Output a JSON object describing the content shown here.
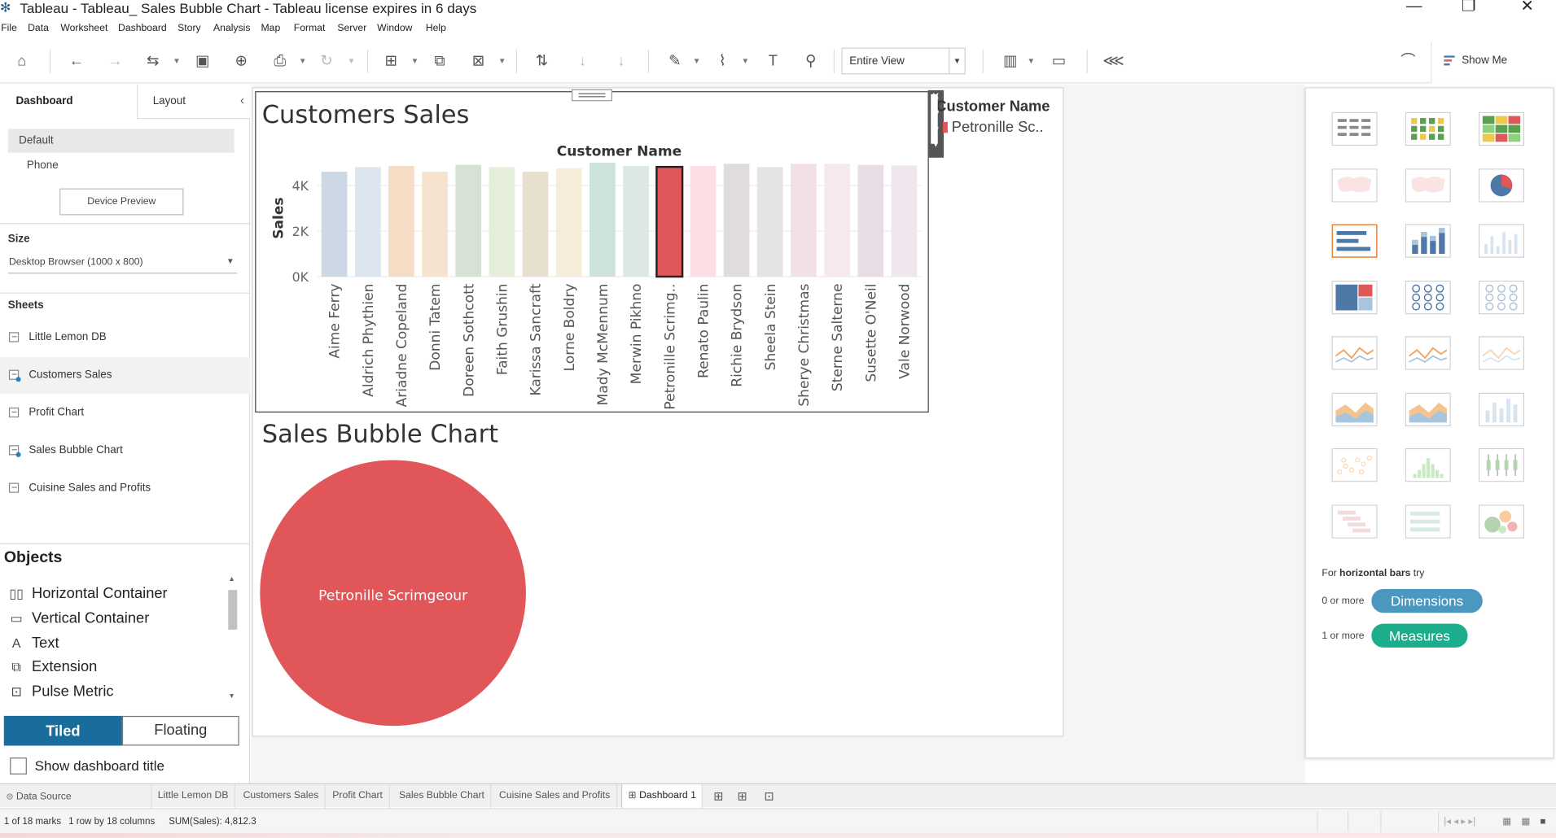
{
  "window": {
    "title": "Tableau - Tableau_ Sales Bubble Chart - Tableau license expires in 6 days"
  },
  "menu": [
    "File",
    "Data",
    "Worksheet",
    "Dashboard",
    "Story",
    "Analysis",
    "Map",
    "Format",
    "Server",
    "Window",
    "Help"
  ],
  "toolbar": {
    "fit_value": "Entire View",
    "show_me_label": "Show Me"
  },
  "left_panel": {
    "tabs": {
      "dashboard": "Dashboard",
      "layout": "Layout"
    },
    "devices": {
      "default": "Default",
      "phone": "Phone",
      "preview_button": "Device Preview"
    },
    "size": {
      "label": "Size",
      "value": "Desktop Browser (1000 x 800)"
    },
    "sheets_label": "Sheets",
    "sheets": [
      {
        "label": "Little Lemon DB",
        "used": false,
        "selected": false
      },
      {
        "label": "Customers Sales",
        "used": true,
        "selected": true
      },
      {
        "label": "Profit Chart",
        "used": false,
        "selected": false
      },
      {
        "label": "Sales Bubble Chart",
        "used": true,
        "selected": false
      },
      {
        "label": "Cuisine Sales and Profits",
        "used": false,
        "selected": false
      }
    ],
    "objects_label": "Objects",
    "objects": [
      {
        "label": "Horizontal Container",
        "icon": "horizontal-container-icon",
        "glyph": "▯▯"
      },
      {
        "label": "Vertical Container",
        "icon": "vertical-container-icon",
        "glyph": "▭"
      },
      {
        "label": "Text",
        "icon": "text-icon",
        "glyph": "A"
      },
      {
        "label": "Extension",
        "icon": "extension-icon",
        "glyph": "⧉"
      },
      {
        "label": "Pulse Metric",
        "icon": "pulse-metric-icon",
        "glyph": "⊡"
      }
    ],
    "tiled_label": "Tiled",
    "floating_label": "Floating",
    "show_title_label": "Show dashboard title"
  },
  "dashboard": {
    "customers_sales_title": "Customers Sales",
    "legend_title": "Customer Name",
    "legend_item": "Petronille Sc..",
    "bubble_title": "Sales Bubble Chart"
  },
  "chart_data": [
    {
      "type": "bar",
      "title": "Customers Sales",
      "xlabel": "Customer Name",
      "ylabel": "Sales",
      "ylim": [
        0,
        5000
      ],
      "yticks": [
        "4K",
        "2K",
        "0K"
      ],
      "ytick_values": [
        4000,
        2000,
        0
      ],
      "categories": [
        "Aime Ferry",
        "Aldrich Phythien",
        "Ariadne Copeland",
        "Donni Tatem",
        "Doreen Sothcott",
        "Faith Grushin",
        "Karissa Sancraft",
        "Lorne Boldry",
        "Mady McMennum",
        "Merwin Pikhno",
        "Petronille Scrimg..",
        "Renato Paulin",
        "Richie Brydson",
        "Sheela Stein",
        "Sherye Christmas",
        "Sterne Salterne",
        "Susette O'Neil",
        "Vale Norwood"
      ],
      "values": [
        4600,
        4800,
        4850,
        4600,
        4900,
        4800,
        4600,
        4750,
        5000,
        4850,
        4812.3,
        4850,
        4950,
        4800,
        4950,
        4950,
        4900,
        4880
      ],
      "colors": [
        "#cdd8e6",
        "#dde6ef",
        "#f5dcc4",
        "#f6e3cf",
        "#d6e3d4",
        "#e4eed9",
        "#e7e0cf",
        "#f5edd9",
        "#cde2dc",
        "#dce8e3",
        "#e15759",
        "#fbdfe2",
        "#e0dcdc",
        "#e5e3e3",
        "#f3e0e6",
        "#f7e8ec",
        "#e8dde6",
        "#efe6ee"
      ],
      "highlight_index": 10
    },
    {
      "type": "bubble",
      "title": "Sales Bubble Chart",
      "labels": [
        "Petronille Scrimgeour"
      ],
      "values": [
        4812.3
      ],
      "colors": [
        "#e15759"
      ]
    }
  ],
  "show_me": {
    "hint_prefix": "For ",
    "hint_bold": "horizontal bars",
    "hint_suffix": " try",
    "dimensions_req": "0 or more",
    "dimensions_label": "Dimensions",
    "measures_req": "1 or more",
    "measures_label": "Measures",
    "charts": [
      "text-table",
      "heat-map",
      "highlight-table",
      "symbol-map",
      "filled-map",
      "pie-chart",
      "horizontal-bars",
      "stacked-bars",
      "side-by-side-bars",
      "treemap",
      "circle-views",
      "side-by-side-circles",
      "continuous-lines",
      "discrete-lines",
      "dual-lines",
      "area-continuous",
      "area-discrete",
      "dual-combination",
      "scatter-plot",
      "histogram",
      "box-and-whisker",
      "gantt-chart",
      "bullet-graph",
      "packed-bubbles"
    ],
    "selected_chart": "horizontal-bars"
  },
  "bottom_tabs": {
    "data_source": "Data Source",
    "sheets": [
      "Little Lemon DB",
      "Customers Sales",
      "Profit Chart",
      "Sales Bubble Chart",
      "Cuisine Sales and Profits"
    ],
    "active": "Dashboard 1"
  },
  "status": {
    "marks": "1 of 18 marks",
    "rows": "1 row by 18 columns",
    "sum": "SUM(Sales): 4,812.3"
  }
}
